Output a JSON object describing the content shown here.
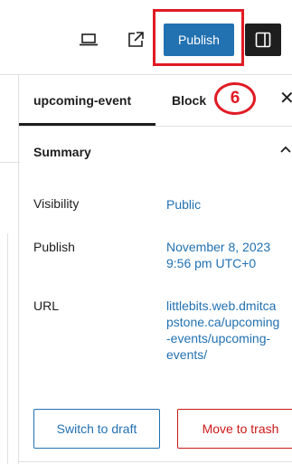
{
  "toolbar": {
    "preview_icon": "laptop-icon",
    "view_post_icon": "external-link-icon",
    "publish_label": "Publish",
    "settings_icon": "sidebar-toggle-icon"
  },
  "annotation": {
    "step_number": "6",
    "color": "#e01b24"
  },
  "sidebar": {
    "tabs": [
      {
        "label": "upcoming-event"
      },
      {
        "label": "Block"
      }
    ],
    "close_label": "✕",
    "summary": {
      "title": "Summary",
      "rows": [
        {
          "label": "Visibility",
          "value": "Public"
        },
        {
          "label": "Publish",
          "value_line1": "November 8, 2023",
          "value_line2": "9:56 pm UTC+0"
        },
        {
          "label": "URL",
          "value": "littlebits.web.dmitcapstone.ca/upcoming-events/upcoming-events/"
        }
      ]
    },
    "actions": {
      "switch_to_draft": "Switch to draft",
      "move_to_trash": "Move to trash"
    }
  },
  "colors": {
    "accent": "#2271b1",
    "danger": "#cc1818",
    "text": "#1e1e1e"
  }
}
